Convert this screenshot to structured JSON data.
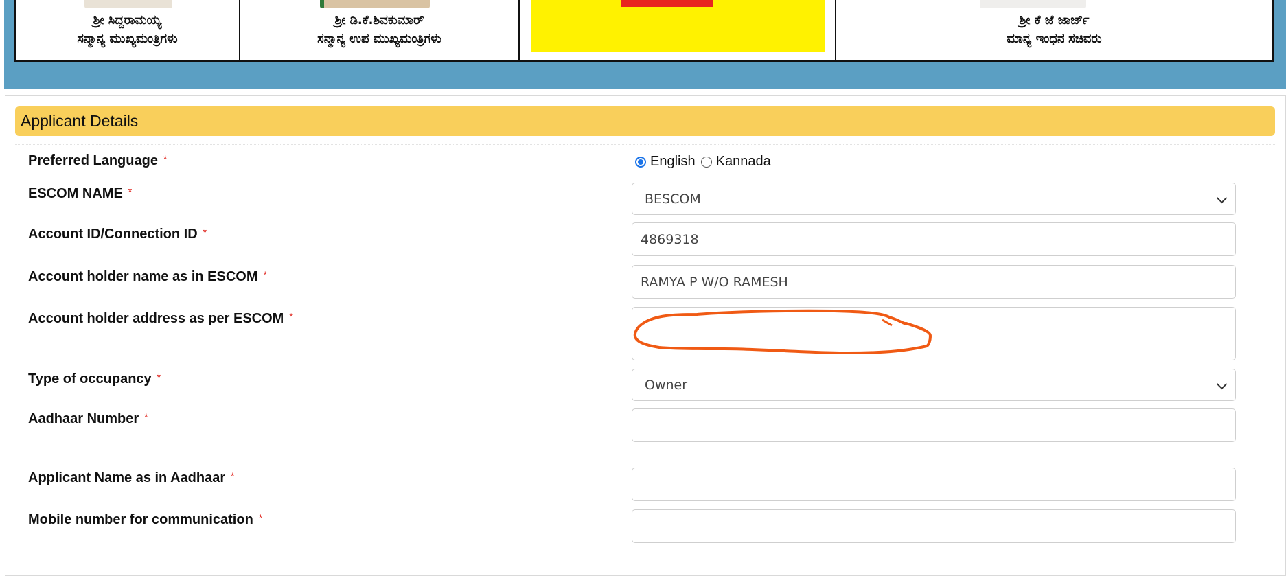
{
  "banner": {
    "cells": [
      {
        "line1": "ಶ್ರೀ ಸಿದ್ದರಾಮಯ್ಯ",
        "line2": "ಸನ್ಮಾನ್ಯ ಮುಖ್ಯಮಂತ್ರಿಗಳು"
      },
      {
        "line1": "ಶ್ರೀ ಡಿ.ಕೆ.ಶಿವಕುಮಾರ್",
        "line2": "ಸನ್ಮಾನ್ಯ ಉಪ ಮುಖ್ಯಮಂತ್ರಿಗಳು"
      },
      {
        "line1": "",
        "line2": ""
      },
      {
        "line1": "ಶ್ರೀ ಕೆ ಜೆ ಜಾರ್ಜ್",
        "line2": "ಮಾನ್ಯ ಇಂಧನ ಸಚಿವರು"
      }
    ]
  },
  "section": {
    "title": "Applicant Details"
  },
  "form": {
    "required_mark": "*",
    "preferred_language": {
      "label": "Preferred Language",
      "options": [
        "English",
        "Kannada"
      ],
      "selected": "English"
    },
    "escom_name": {
      "label": "ESCOM NAME",
      "value": "BESCOM"
    },
    "account_id": {
      "label": "Account ID/Connection ID",
      "value": "4869318"
    },
    "account_holder_name": {
      "label": "Account holder name as in ESCOM",
      "value": "RAMYA P W/O RAMESH"
    },
    "account_holder_address": {
      "label": "Account holder address as per ESCOM",
      "value": ""
    },
    "occupancy_type": {
      "label": "Type of occupancy",
      "value": "Owner"
    },
    "aadhaar_number": {
      "label": "Aadhaar Number",
      "value": ""
    },
    "applicant_name": {
      "label": "Applicant Name as in Aadhaar",
      "value": ""
    },
    "mobile_number": {
      "label": "Mobile number for communication",
      "value": ""
    }
  },
  "colors": {
    "banner_bg": "#5b9fc3",
    "section_header": "#f9cf5b",
    "required": "#e0261f",
    "annotation": "#f05a14"
  }
}
